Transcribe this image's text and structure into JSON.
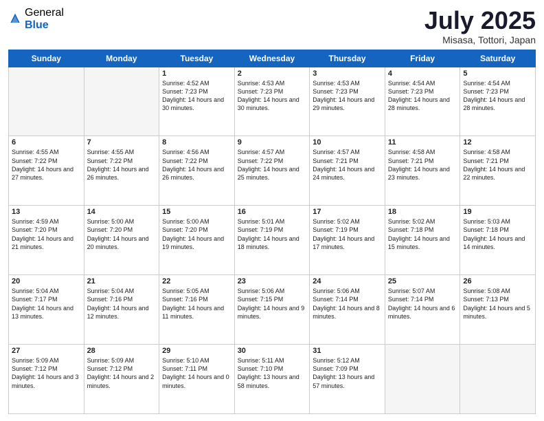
{
  "logo": {
    "general": "General",
    "blue": "Blue"
  },
  "title": "July 2025",
  "location": "Misasa, Tottori, Japan",
  "days_header": [
    "Sunday",
    "Monday",
    "Tuesday",
    "Wednesday",
    "Thursday",
    "Friday",
    "Saturday"
  ],
  "weeks": [
    [
      {
        "day": "",
        "empty": true
      },
      {
        "day": "",
        "empty": true
      },
      {
        "day": "1",
        "sunrise": "4:52 AM",
        "sunset": "7:23 PM",
        "daylight": "14 hours and 30 minutes."
      },
      {
        "day": "2",
        "sunrise": "4:53 AM",
        "sunset": "7:23 PM",
        "daylight": "14 hours and 30 minutes."
      },
      {
        "day": "3",
        "sunrise": "4:53 AM",
        "sunset": "7:23 PM",
        "daylight": "14 hours and 29 minutes."
      },
      {
        "day": "4",
        "sunrise": "4:54 AM",
        "sunset": "7:23 PM",
        "daylight": "14 hours and 28 minutes."
      },
      {
        "day": "5",
        "sunrise": "4:54 AM",
        "sunset": "7:23 PM",
        "daylight": "14 hours and 28 minutes."
      }
    ],
    [
      {
        "day": "6",
        "sunrise": "4:55 AM",
        "sunset": "7:22 PM",
        "daylight": "14 hours and 27 minutes."
      },
      {
        "day": "7",
        "sunrise": "4:55 AM",
        "sunset": "7:22 PM",
        "daylight": "14 hours and 26 minutes."
      },
      {
        "day": "8",
        "sunrise": "4:56 AM",
        "sunset": "7:22 PM",
        "daylight": "14 hours and 26 minutes."
      },
      {
        "day": "9",
        "sunrise": "4:57 AM",
        "sunset": "7:22 PM",
        "daylight": "14 hours and 25 minutes."
      },
      {
        "day": "10",
        "sunrise": "4:57 AM",
        "sunset": "7:21 PM",
        "daylight": "14 hours and 24 minutes."
      },
      {
        "day": "11",
        "sunrise": "4:58 AM",
        "sunset": "7:21 PM",
        "daylight": "14 hours and 23 minutes."
      },
      {
        "day": "12",
        "sunrise": "4:58 AM",
        "sunset": "7:21 PM",
        "daylight": "14 hours and 22 minutes."
      }
    ],
    [
      {
        "day": "13",
        "sunrise": "4:59 AM",
        "sunset": "7:20 PM",
        "daylight": "14 hours and 21 minutes."
      },
      {
        "day": "14",
        "sunrise": "5:00 AM",
        "sunset": "7:20 PM",
        "daylight": "14 hours and 20 minutes."
      },
      {
        "day": "15",
        "sunrise": "5:00 AM",
        "sunset": "7:20 PM",
        "daylight": "14 hours and 19 minutes."
      },
      {
        "day": "16",
        "sunrise": "5:01 AM",
        "sunset": "7:19 PM",
        "daylight": "14 hours and 18 minutes."
      },
      {
        "day": "17",
        "sunrise": "5:02 AM",
        "sunset": "7:19 PM",
        "daylight": "14 hours and 17 minutes."
      },
      {
        "day": "18",
        "sunrise": "5:02 AM",
        "sunset": "7:18 PM",
        "daylight": "14 hours and 15 minutes."
      },
      {
        "day": "19",
        "sunrise": "5:03 AM",
        "sunset": "7:18 PM",
        "daylight": "14 hours and 14 minutes."
      }
    ],
    [
      {
        "day": "20",
        "sunrise": "5:04 AM",
        "sunset": "7:17 PM",
        "daylight": "14 hours and 13 minutes."
      },
      {
        "day": "21",
        "sunrise": "5:04 AM",
        "sunset": "7:16 PM",
        "daylight": "14 hours and 12 minutes."
      },
      {
        "day": "22",
        "sunrise": "5:05 AM",
        "sunset": "7:16 PM",
        "daylight": "14 hours and 11 minutes."
      },
      {
        "day": "23",
        "sunrise": "5:06 AM",
        "sunset": "7:15 PM",
        "daylight": "14 hours and 9 minutes."
      },
      {
        "day": "24",
        "sunrise": "5:06 AM",
        "sunset": "7:14 PM",
        "daylight": "14 hours and 8 minutes."
      },
      {
        "day": "25",
        "sunrise": "5:07 AM",
        "sunset": "7:14 PM",
        "daylight": "14 hours and 6 minutes."
      },
      {
        "day": "26",
        "sunrise": "5:08 AM",
        "sunset": "7:13 PM",
        "daylight": "14 hours and 5 minutes."
      }
    ],
    [
      {
        "day": "27",
        "sunrise": "5:09 AM",
        "sunset": "7:12 PM",
        "daylight": "14 hours and 3 minutes."
      },
      {
        "day": "28",
        "sunrise": "5:09 AM",
        "sunset": "7:12 PM",
        "daylight": "14 hours and 2 minutes."
      },
      {
        "day": "29",
        "sunrise": "5:10 AM",
        "sunset": "7:11 PM",
        "daylight": "14 hours and 0 minutes."
      },
      {
        "day": "30",
        "sunrise": "5:11 AM",
        "sunset": "7:10 PM",
        "daylight": "13 hours and 58 minutes."
      },
      {
        "day": "31",
        "sunrise": "5:12 AM",
        "sunset": "7:09 PM",
        "daylight": "13 hours and 57 minutes."
      },
      {
        "day": "",
        "empty": true
      },
      {
        "day": "",
        "empty": true
      }
    ]
  ]
}
